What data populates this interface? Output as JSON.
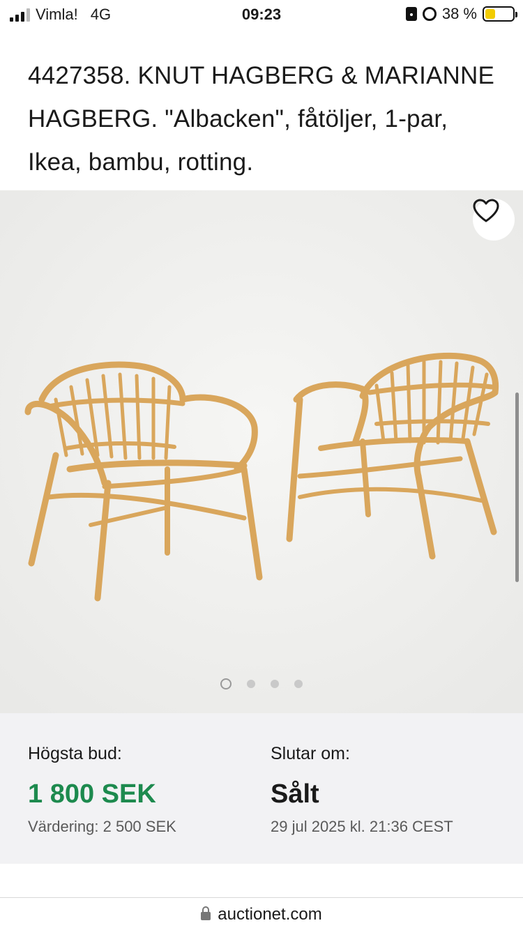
{
  "status_bar": {
    "carrier": "Vimla!",
    "network": "4G",
    "time": "09:23",
    "battery_text": "38 %",
    "battery_level": 0.38,
    "battery_color": "#f2cc00"
  },
  "listing": {
    "title": "4427358. KNUT HAGBERG & MARIANNE HAGBERG. \"Albacken\", fåtöljer, 1-par, Ikea, bambu, rotting."
  },
  "gallery": {
    "favorite_icon": "heart-icon",
    "image_count": 4,
    "active_index": 0
  },
  "bid": {
    "label": "Högsta bud:",
    "amount": "1 800 SEK",
    "amount_color": "#1d8a4e",
    "estimate": "Värdering: 2 500 SEK"
  },
  "ends": {
    "label": "Slutar om:",
    "status": "Sålt",
    "date": "29 jul 2025 kl. 21:36 CEST"
  },
  "browser": {
    "url": "auctionet.com",
    "lock_icon": "lock-icon"
  }
}
